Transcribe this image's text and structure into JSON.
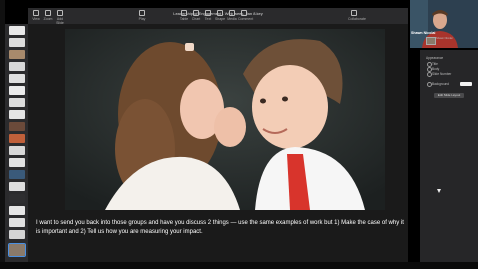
{
  "toolbar": {
    "document_title": "Leadership of Engagement - Web week, Jan 8.key",
    "buttons": [
      "View",
      "Zoom",
      "Add Slide",
      "Play",
      "Table",
      "Chart",
      "Text",
      "Shape",
      "Media",
      "Comment",
      "Collaborate",
      "Format",
      "Animate",
      "Document"
    ]
  },
  "video": {
    "participant_name": "Shawn Nicolai",
    "small_label": "Shawn Nicolai"
  },
  "inspector": {
    "section": "Appearance",
    "options": [
      "Title",
      "Body",
      "Slide Number"
    ],
    "background_label": "Background",
    "edit_button": "Edit Slide Layout"
  },
  "caption": "I want to send you back into those groups and have you discuss 2 things — use the same examples of work but 1) Make the case of why it is important and 2) Tell us how you are measuring your impact.",
  "colors": {
    "accent": "#4a90e2",
    "toolbar": "#2a2a2c",
    "panel": "#262628"
  }
}
